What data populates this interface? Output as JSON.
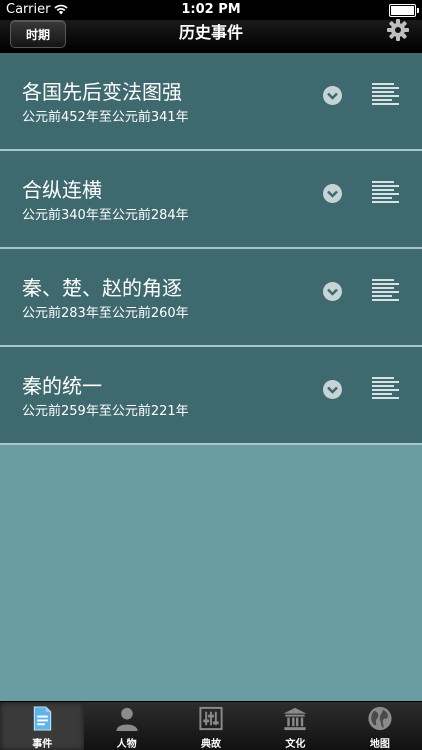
{
  "status": {
    "carrier": "Carrier",
    "time": "1:02 PM"
  },
  "nav": {
    "period_label": "时期",
    "title": "历史事件"
  },
  "events": [
    {
      "title": "各国先后变法图强",
      "date": "公元前452年至公元前341年"
    },
    {
      "title": "合纵连横",
      "date": "公元前340年至公元前284年"
    },
    {
      "title": "秦、楚、赵的角逐",
      "date": "公元前283年至公元前260年"
    },
    {
      "title": "秦的统一",
      "date": "公元前259年至公元前221年"
    }
  ],
  "tabs": [
    {
      "label": "事件",
      "icon": "document-icon",
      "active": true
    },
    {
      "label": "人物",
      "icon": "person-icon",
      "active": false
    },
    {
      "label": "典故",
      "icon": "equalizer-icon",
      "active": false
    },
    {
      "label": "文化",
      "icon": "temple-icon",
      "active": false
    },
    {
      "label": "地图",
      "icon": "globe-icon",
      "active": false
    }
  ],
  "colors": {
    "row_bg": "#3e6a6f",
    "body_bg": "#6a9ca3",
    "divider": "#a9c6c9"
  }
}
